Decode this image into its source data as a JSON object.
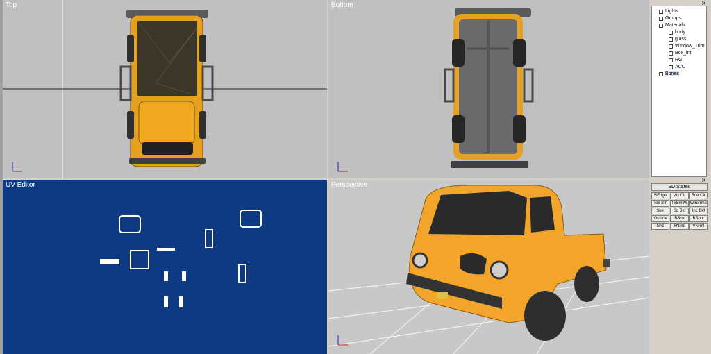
{
  "viewports": {
    "top": {
      "label": "Top"
    },
    "bottom": {
      "label": "Bottom"
    },
    "uv": {
      "label": "UV Editor"
    },
    "perspective": {
      "label": "Perspective"
    }
  },
  "tree": {
    "items": [
      {
        "label": "Lights",
        "icon": "light-icon"
      },
      {
        "label": "Groups",
        "icon": "group-icon"
      },
      {
        "label": "Materials",
        "icon": "materials-icon"
      },
      {
        "label": "body",
        "icon": "material-icon"
      },
      {
        "label": "glass",
        "icon": "material-icon"
      },
      {
        "label": "Window_Trim",
        "icon": "material-icon"
      },
      {
        "label": "Box_int",
        "icon": "material-icon"
      },
      {
        "label": "RG",
        "icon": "material-icon"
      },
      {
        "label": "ACC",
        "icon": "material-icon"
      },
      {
        "label": "Bones",
        "icon": "bones-icon"
      }
    ]
  },
  "states": {
    "title": "3D States",
    "buttons": [
      "BEdge",
      "Vtx Clr",
      "Bne Clr",
      "Tex Sm",
      "TxSmWr",
      "Wirefrme",
      "Skel",
      "Sd Bkf",
      "Inc Bkf",
      "Outline",
      "BBox",
      "BSphr",
      "Grid",
      "FNrml",
      "VNrml"
    ]
  },
  "colors": {
    "body": "#f0a020",
    "uv_background": "#0d3a82",
    "viewport_grey": "#c0c0c0"
  },
  "axes": {
    "x": "x",
    "z": "z"
  }
}
